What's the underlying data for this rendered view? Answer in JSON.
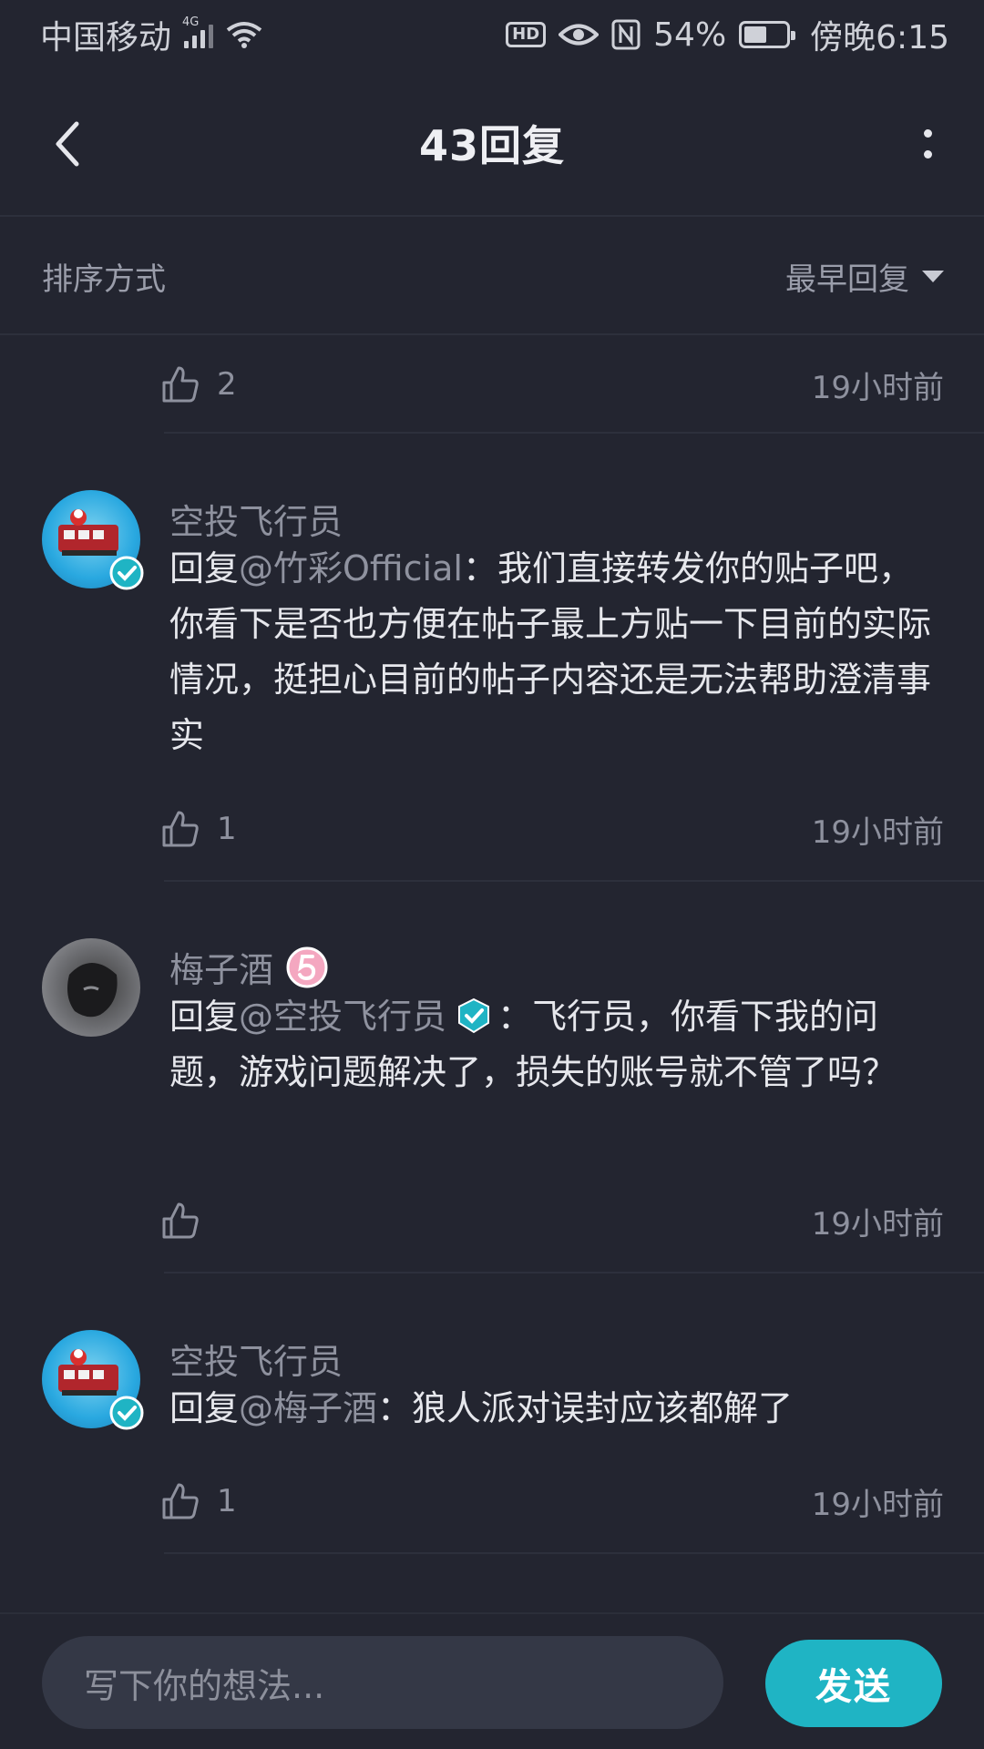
{
  "status_bar": {
    "carrier": "中国移动",
    "network": "4G",
    "hd": "HD",
    "battery_percent": "54%",
    "time": "傍晚6:15"
  },
  "header": {
    "title": "43回复"
  },
  "sort": {
    "label": "排序方式",
    "value": "最早回复"
  },
  "partial": {
    "likes": "2",
    "time": "19小时前"
  },
  "comments": [
    {
      "username": "空投飞行员",
      "reply_prefix": "回复",
      "mention": "@竹彩Official",
      "text": "：我们直接转发你的贴子吧，你看下是否也方便在帖子最上方贴一下目前的实际情况，挺担心目前的帖子内容还是无法帮助澄清事实",
      "likes": "1",
      "time": "19小时前"
    },
    {
      "username": "梅子酒",
      "reply_prefix": "回复",
      "mention": "@空投飞行员",
      "text": "：飞行员，你看下我的问题，游戏问题解决了，损失的账号就不管了吗？",
      "likes": "",
      "time": "19小时前"
    },
    {
      "username": "空投飞行员",
      "reply_prefix": "回复",
      "mention": "@梅子酒",
      "text": "：狼人派对误封应该都解了",
      "likes": "1",
      "time": "19小时前"
    }
  ],
  "composer": {
    "placeholder": "写下你的想法...",
    "send_label": "发送"
  },
  "colors": {
    "background": "#232530",
    "accent": "#1fb4c4",
    "verified_badge": "#1fb4c4",
    "level_badge": "#f4a7c0"
  },
  "icons": [
    "back-arrow-icon",
    "more-vertical-icon",
    "dropdown-caret-icon",
    "thumbs-up-icon",
    "verified-badge-icon",
    "level-badge-icon"
  ]
}
